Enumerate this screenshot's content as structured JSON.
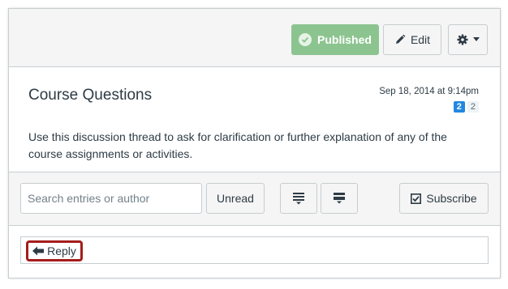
{
  "header": {
    "published_label": "Published",
    "edit_label": "Edit"
  },
  "topic": {
    "title": "Course Questions",
    "date": "Sep 18, 2014 at 9:14pm",
    "unread_count": "2",
    "total_count": "2",
    "body": "Use this discussion thread to ask for clarification or further explanation of any of the course assignments or activities."
  },
  "toolbar": {
    "search_placeholder": "Search entries or author",
    "unread_label": "Unread",
    "subscribe_label": "Subscribe"
  },
  "reply": {
    "label": "Reply"
  },
  "colors": {
    "published_bg": "#8cc490",
    "unread_badge": "#2287e0",
    "highlight_border": "#a51c1c"
  },
  "icons": {
    "published": "check-circle-icon",
    "edit": "pencil-icon",
    "settings": "gear-icon",
    "settings_menu": "caret-down-icon",
    "collapse": "collapse-replies-icon",
    "expand": "expand-replies-icon",
    "subscribe": "checkbox-icon",
    "reply": "arrow-left-icon"
  }
}
